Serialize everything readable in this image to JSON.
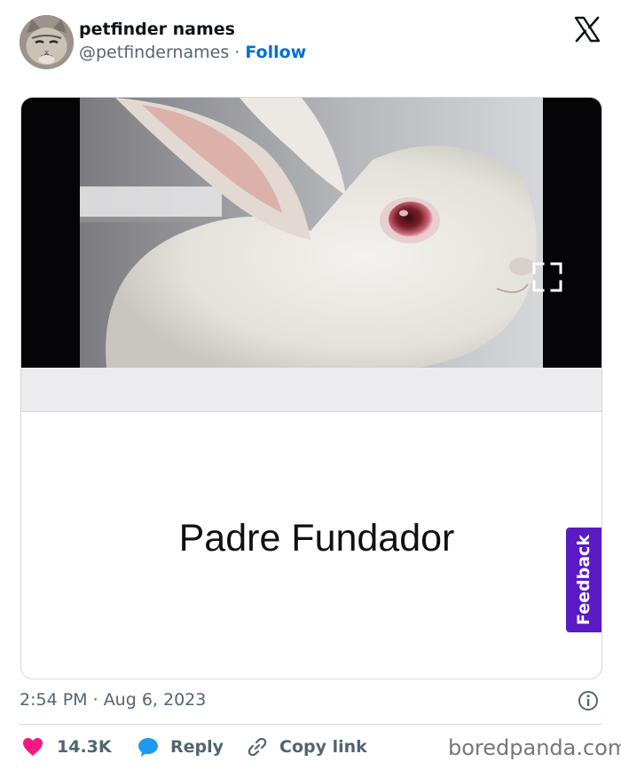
{
  "header": {
    "display_name": "petfinder names",
    "handle": "@petfindernames",
    "separator": " · ",
    "follow_label": "Follow"
  },
  "media": {
    "caption": "Padre Fundador",
    "feedback_label": "Feedback"
  },
  "meta": {
    "time": "2:54 PM",
    "separator": " · ",
    "date": "Aug 6, 2023"
  },
  "actions": {
    "likes": "14.3K",
    "reply_label": "Reply",
    "copy_label": "Copy link"
  },
  "watermark": "boredpanda.com",
  "colors": {
    "follow": "#006fd6",
    "like": "#f91880",
    "reply": "#1d9bf0",
    "feedback": "#5a1bc4"
  },
  "icons": {
    "brand": "x-logo-icon",
    "expand": "expand-icon",
    "info": "info-icon",
    "like": "heart-icon",
    "reply": "speech-bubble-icon",
    "copy": "link-icon"
  }
}
